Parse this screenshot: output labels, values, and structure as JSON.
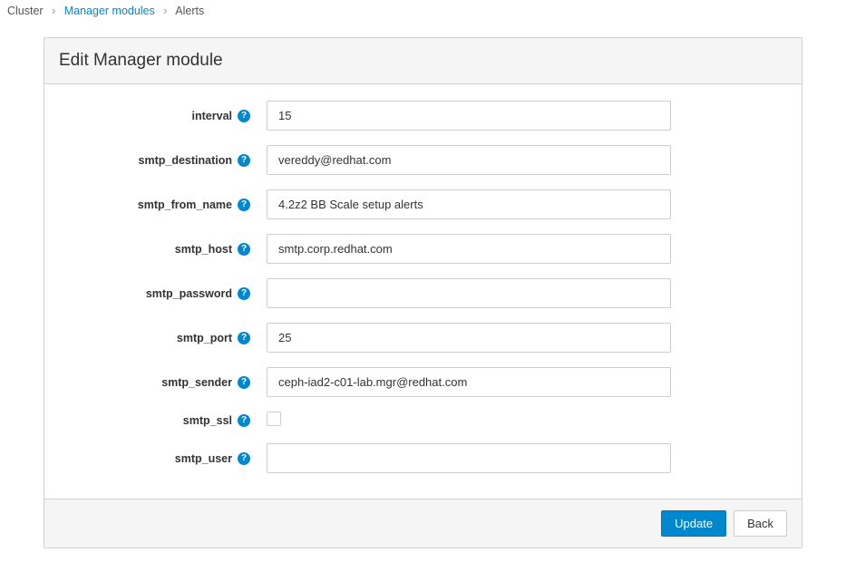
{
  "breadcrumb": {
    "level1": "Cluster",
    "level2": "Manager modules",
    "level3": "Alerts"
  },
  "panel": {
    "title": "Edit Manager module"
  },
  "fields": {
    "interval": {
      "label": "interval",
      "value": "15"
    },
    "smtp_destination": {
      "label": "smtp_destination",
      "value": "vereddy@redhat.com"
    },
    "smtp_from_name": {
      "label": "smtp_from_name",
      "value": "4.2z2 BB Scale setup alerts"
    },
    "smtp_host": {
      "label": "smtp_host",
      "value": "smtp.corp.redhat.com"
    },
    "smtp_password": {
      "label": "smtp_password",
      "value": ""
    },
    "smtp_port": {
      "label": "smtp_port",
      "value": "25"
    },
    "smtp_sender": {
      "label": "smtp_sender",
      "value": "ceph-iad2-c01-lab.mgr@redhat.com"
    },
    "smtp_ssl": {
      "label": "smtp_ssl",
      "checked": false
    },
    "smtp_user": {
      "label": "smtp_user",
      "value": ""
    }
  },
  "buttons": {
    "update": "Update",
    "back": "Back"
  },
  "icons": {
    "help": "?"
  }
}
